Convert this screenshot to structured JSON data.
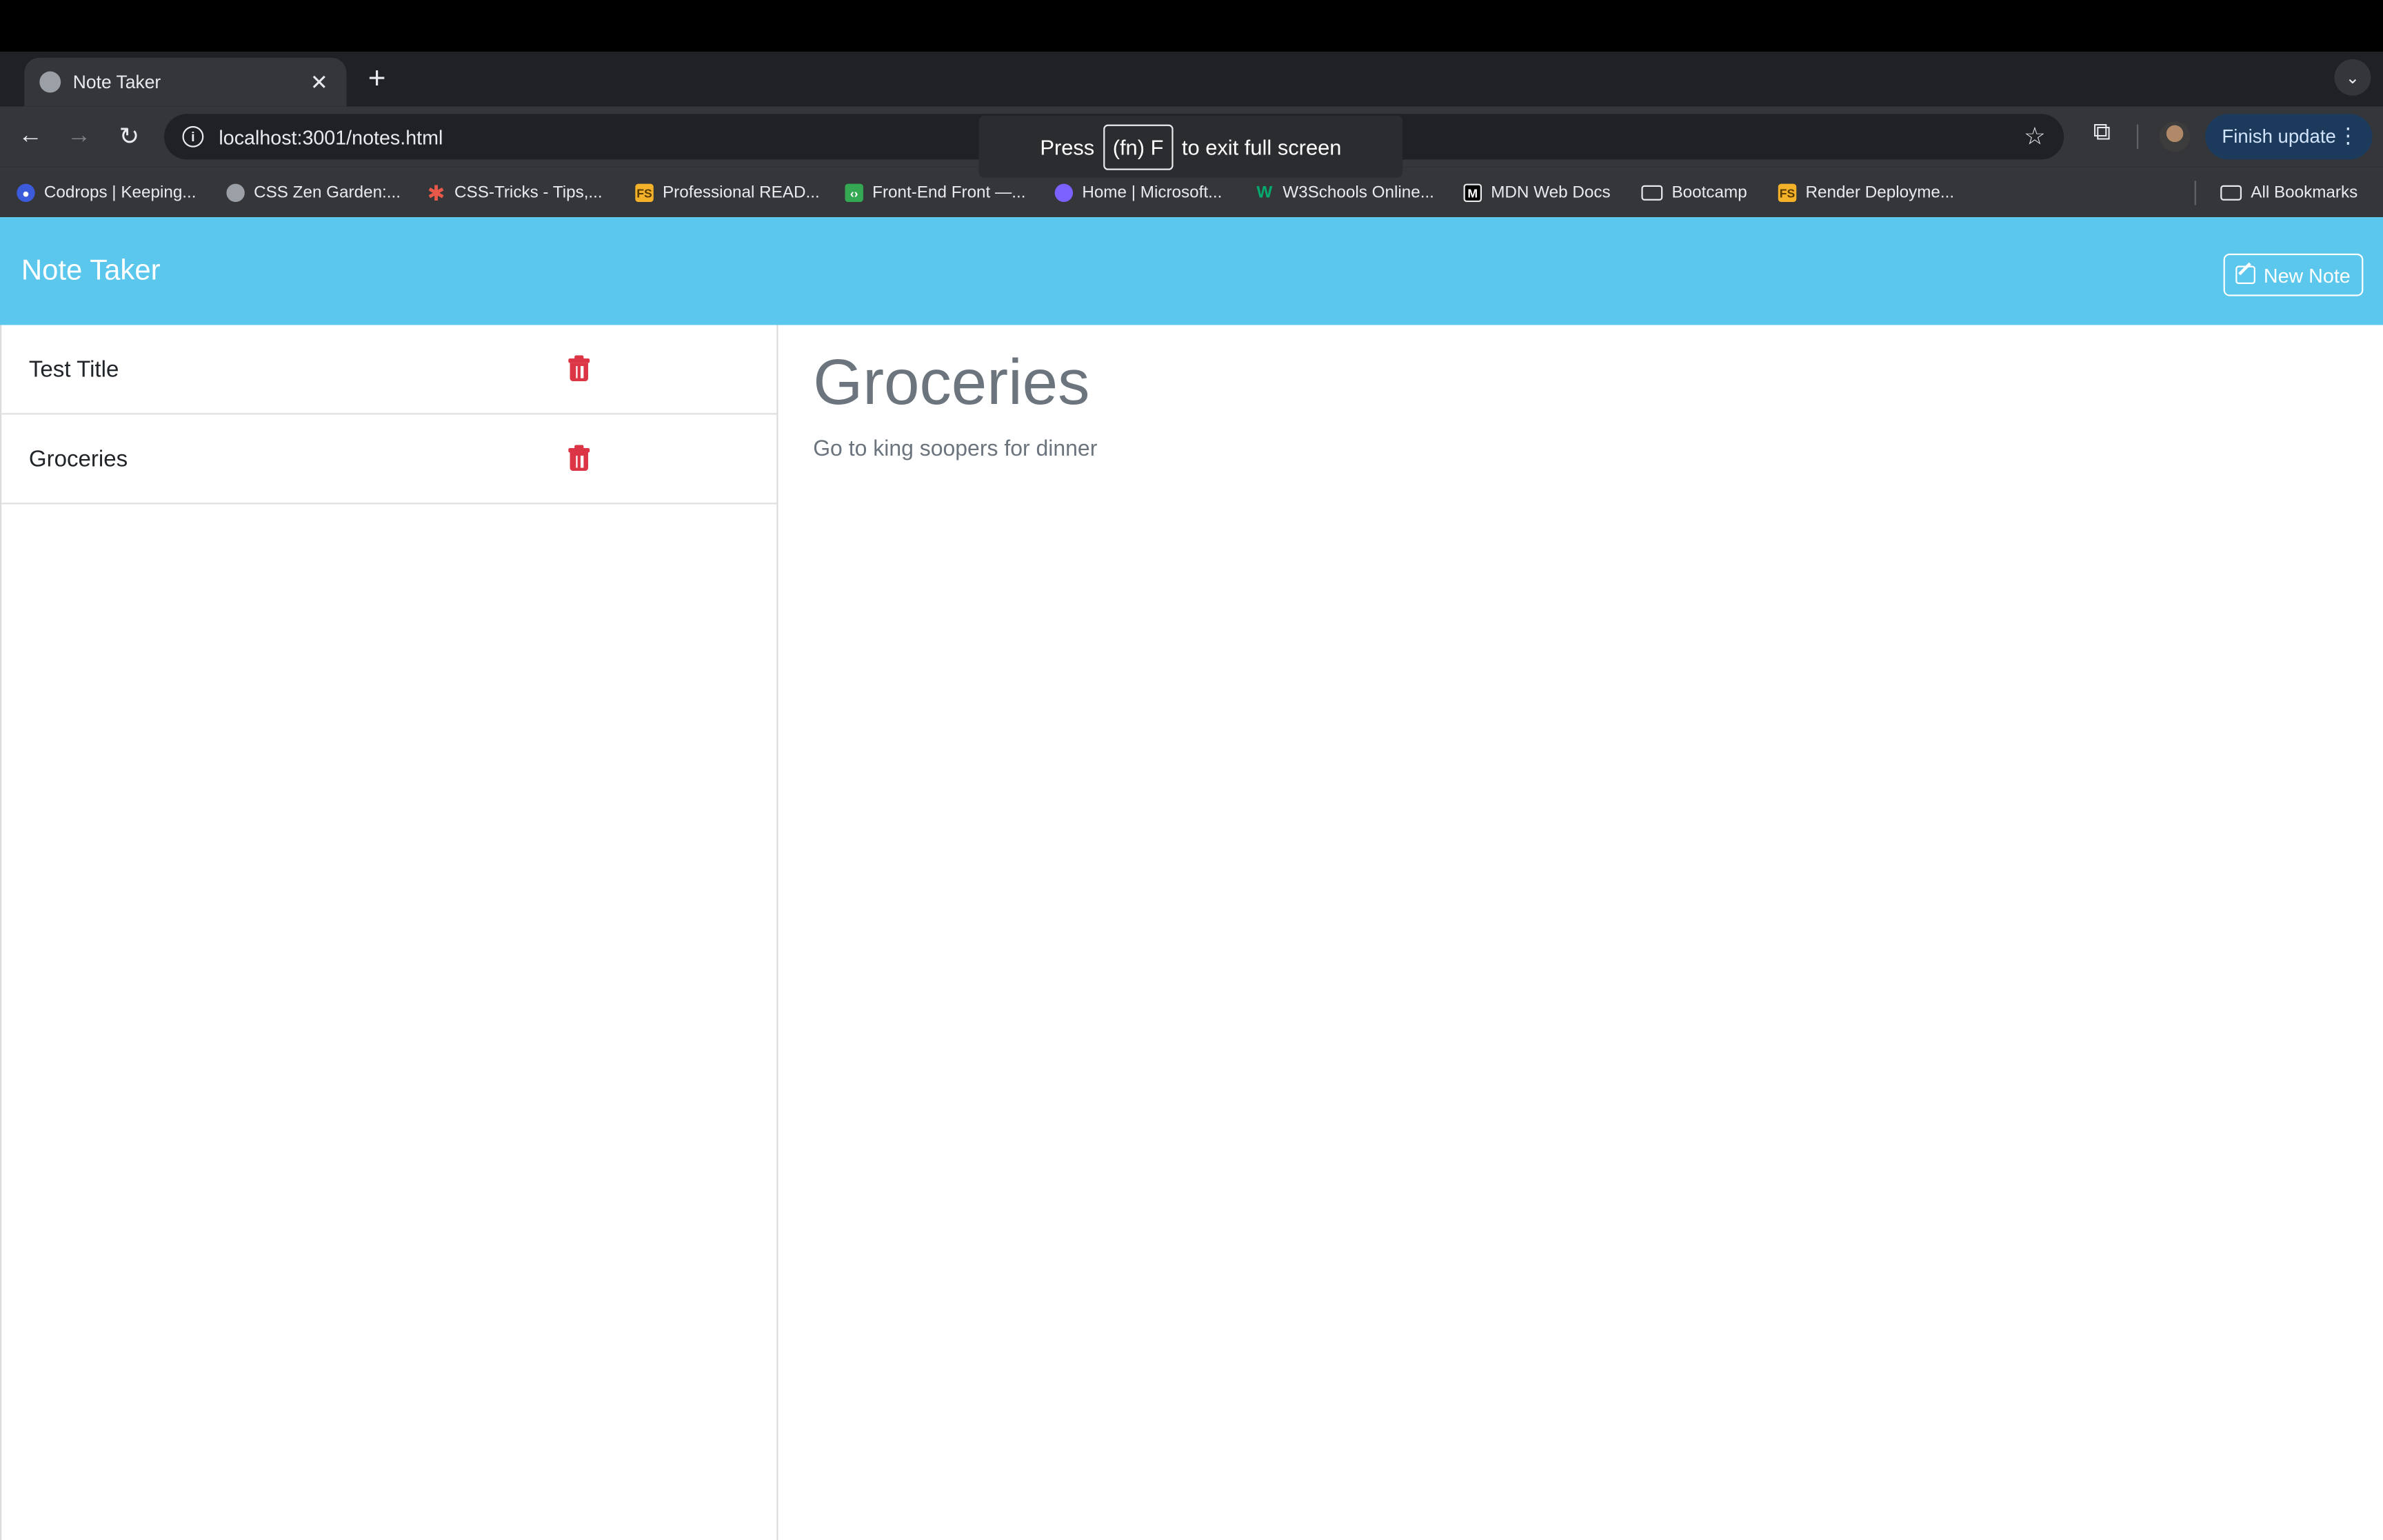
{
  "browser": {
    "tab": {
      "title": "Note Taker",
      "close_glyph": "✕"
    },
    "new_tab_glyph": "+",
    "tab_search_glyph": "⌄",
    "toolbar": {
      "back_glyph": "←",
      "forward_glyph": "→",
      "reload_glyph": "↻",
      "info_glyph": "i",
      "url": "localhost:3001/notes.html",
      "star_glyph": "☆",
      "extensions_glyph": "⧉",
      "update_label": "Finish update",
      "kebab_glyph": "⋮"
    },
    "fullscreen_toast": {
      "press": "Press",
      "key": "(fn) F",
      "rest": "to exit full screen"
    },
    "bookmarks": [
      {
        "label": "Codrops | Keeping...",
        "icon": "codrops-icon",
        "color": "#3b5bdb"
      },
      {
        "label": "CSS Zen Garden:...",
        "icon": "globe-icon",
        "color": "#9aa0a6"
      },
      {
        "label": "CSS-Tricks - Tips,...",
        "icon": "asterisk-icon",
        "color": "#e8594a"
      },
      {
        "label": "Professional READ...",
        "icon": "fs-icon",
        "color": "#f3b22a"
      },
      {
        "label": "Front-End Front —...",
        "icon": "frontend-icon",
        "color": "#34a853"
      },
      {
        "label": "Home | Microsoft...",
        "icon": "microsoft-icon",
        "color": "#7b61ff"
      },
      {
        "label": "W3Schools Online...",
        "icon": "w3schools-icon",
        "color": "#04aa6d"
      },
      {
        "label": "MDN Web Docs",
        "icon": "mdn-icon",
        "color": "#000000"
      },
      {
        "label": "Bootcamp",
        "icon": "folder-icon",
        "color": "#e8eaed"
      },
      {
        "label": "Render Deployme...",
        "icon": "fs-icon",
        "color": "#f3b22a"
      }
    ],
    "all_bookmarks": "All Bookmarks"
  },
  "app": {
    "brand": "Note Taker",
    "new_note_label": "New Note",
    "notes": [
      {
        "title": "Test Title"
      },
      {
        "title": "Groceries"
      }
    ],
    "active_note": {
      "title": "Groceries",
      "text": "Go to king soopers for dinner"
    },
    "colors": {
      "navbar": "#5bc7ec",
      "delete": "#dc3545",
      "muted_text": "#6c757d"
    }
  }
}
